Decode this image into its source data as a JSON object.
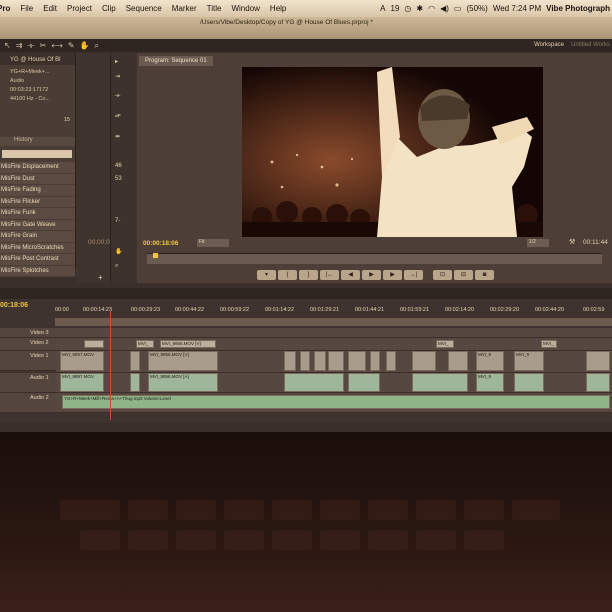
{
  "menubar": {
    "app": "Pro",
    "items": [
      "File",
      "Edit",
      "Project",
      "Clip",
      "Sequence",
      "Marker",
      "Title",
      "Window",
      "Help"
    ],
    "status_count": "19",
    "battery": "(50%)",
    "clock": "Wed 7:24 PM",
    "user": "Vibe Photograph"
  },
  "title": {
    "path": "/Users/Vibe/Desktop/Copy of YG @ House Of Blues.prproj *"
  },
  "toolbar": {
    "workspace_label": "Workspace",
    "workspace_value": "Untitled Works"
  },
  "project": {
    "name": "YG @ House Of Bl",
    "clip_name": "YG+R+Meek+...",
    "clip_type": "Audio",
    "clip_duration": "00:03:23:17172",
    "clip_rate": "44100 Hz - Co...",
    "count": "15"
  },
  "history": {
    "tab_label": "History"
  },
  "effects": [
    "MisFire Displacement",
    "MisFire Dust",
    "MisFire Fading",
    "MisFire Flicker",
    "MisFire Funk",
    "MisFire Gate Weave",
    "MisFire Grain",
    "MisFire MicroScratches",
    "MisFire Post Contrast",
    "MisFire Splotches"
  ],
  "tools": [
    "46",
    "53",
    "7-"
  ],
  "source": {
    "timecode": "00;00;00"
  },
  "program": {
    "tab_label": "Program: Sequence 01",
    "current_time": "00:00:18:06",
    "fit": "Fit",
    "resolution": "1/2",
    "duration": "00:11:44"
  },
  "timeline": {
    "current_time": "00:18:06",
    "ruler": [
      "00:00",
      "00:00:14:23",
      "00:00:29:23",
      "00:00:44:22",
      "00:00:59:22",
      "00:01:14:22",
      "00:01:29:21",
      "00:01:44:21",
      "00:01:59:21",
      "00:02:14:20",
      "00:02:29:20",
      "00:02:44:20",
      "00:02:59"
    ],
    "tracks": {
      "v3": "Video 3",
      "v2": "Video 2",
      "v1": "Video 1",
      "a1": "Audio 1",
      "a2": "Audio 2"
    },
    "clips": {
      "v2_a": "MVI_",
      "v2_b": "MVI_9956.MOV [V]",
      "v2_c": "MVI_",
      "v2_d": "MVI_",
      "v1_a": "MVI_9897.MOV",
      "v1_b": "MVI_9956.MOV [V]",
      "v1_c": "MVI_9",
      "v1_d": "MVI_9",
      "a1_a": "MVI_9897.MOV",
      "a1_b": "MVI_9956.MOV [A]",
      "a1_c": "MVI_9",
      "a2_a": "YG+R+Meek+Mill+Rema+A+Thug.mp3 Volume:Level"
    }
  },
  "colors": {
    "accent_timecode": "#f1c640",
    "playhead": "#d54a2d",
    "audio_clip": "#9fb69a"
  }
}
